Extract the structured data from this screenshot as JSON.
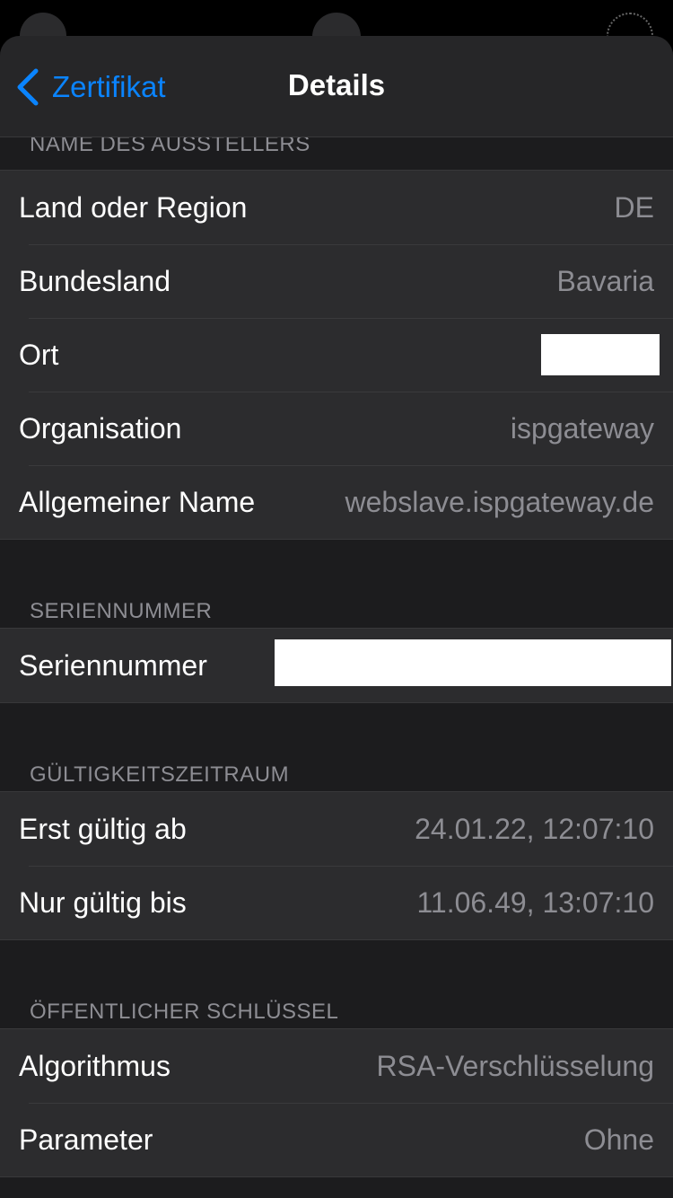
{
  "nav": {
    "back_label": "Zertifikat",
    "title": "Details"
  },
  "sections": {
    "issuer": {
      "header": "NAME DES AUSSTELLERS",
      "rows": [
        {
          "label": "Land oder Region",
          "value": "DE"
        },
        {
          "label": "Bundesland",
          "value": "Bavaria"
        },
        {
          "label": "Ort",
          "value": ""
        },
        {
          "label": "Organisation",
          "value": "ispgateway"
        },
        {
          "label": "Allgemeiner Name",
          "value": "webslave.ispgateway.de"
        }
      ]
    },
    "serial": {
      "header": "SERIENNUMMER",
      "rows": [
        {
          "label": "Seriennummer",
          "value": ""
        }
      ]
    },
    "validity": {
      "header": "GÜLTIGKEITSZEITRAUM",
      "rows": [
        {
          "label": "Erst gültig ab",
          "value": "24.01.22, 12:07:10"
        },
        {
          "label": "Nur gültig bis",
          "value": "11.06.49, 13:07:10"
        }
      ]
    },
    "public_key": {
      "header": "ÖFFENTLICHER SCHLÜSSEL",
      "rows": [
        {
          "label": "Algorithmus",
          "value": "RSA-Verschlüsselung"
        },
        {
          "label": "Parameter",
          "value": "Ohne"
        }
      ]
    }
  },
  "colors": {
    "accent": "#0a84ff",
    "background": "#1c1c1e",
    "cell": "#2c2c2e",
    "secondary_text": "#8d8d93"
  }
}
